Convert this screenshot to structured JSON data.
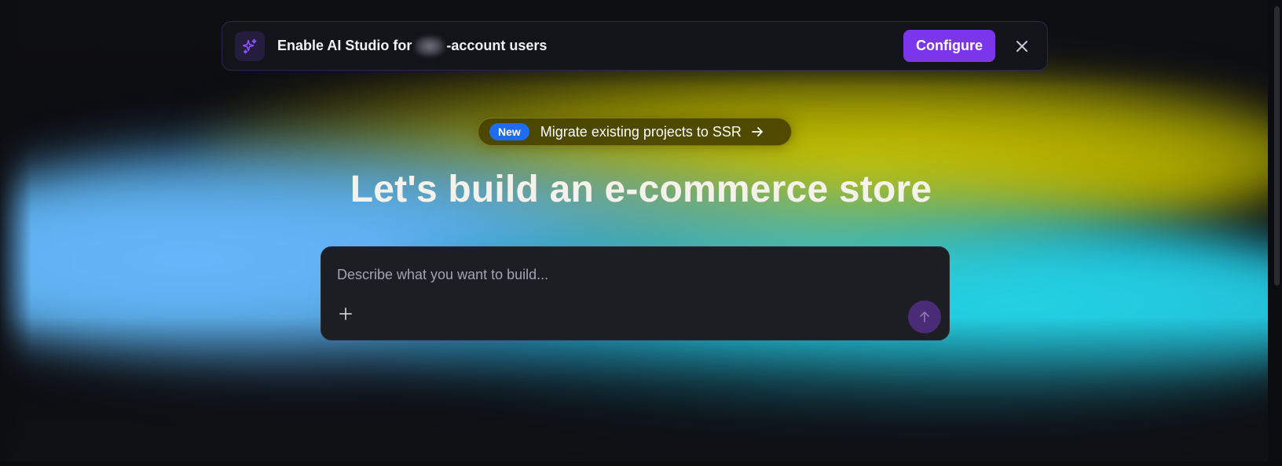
{
  "banner": {
    "text_before": "Enable AI Studio for",
    "text_after": "-account users",
    "configure_label": "Configure",
    "icon": "sparkles-icon",
    "accent_color": "#7b35ea"
  },
  "announcement": {
    "badge": "New",
    "text": "Migrate existing projects to SSR",
    "icon": "arrow-right-icon",
    "badge_color": "#1d6cf2"
  },
  "hero": {
    "title": "Let's build an e-commerce store"
  },
  "prompt": {
    "placeholder": "Describe what you want to build...",
    "add_icon": "plus-icon",
    "send_icon": "arrow-up-icon"
  }
}
